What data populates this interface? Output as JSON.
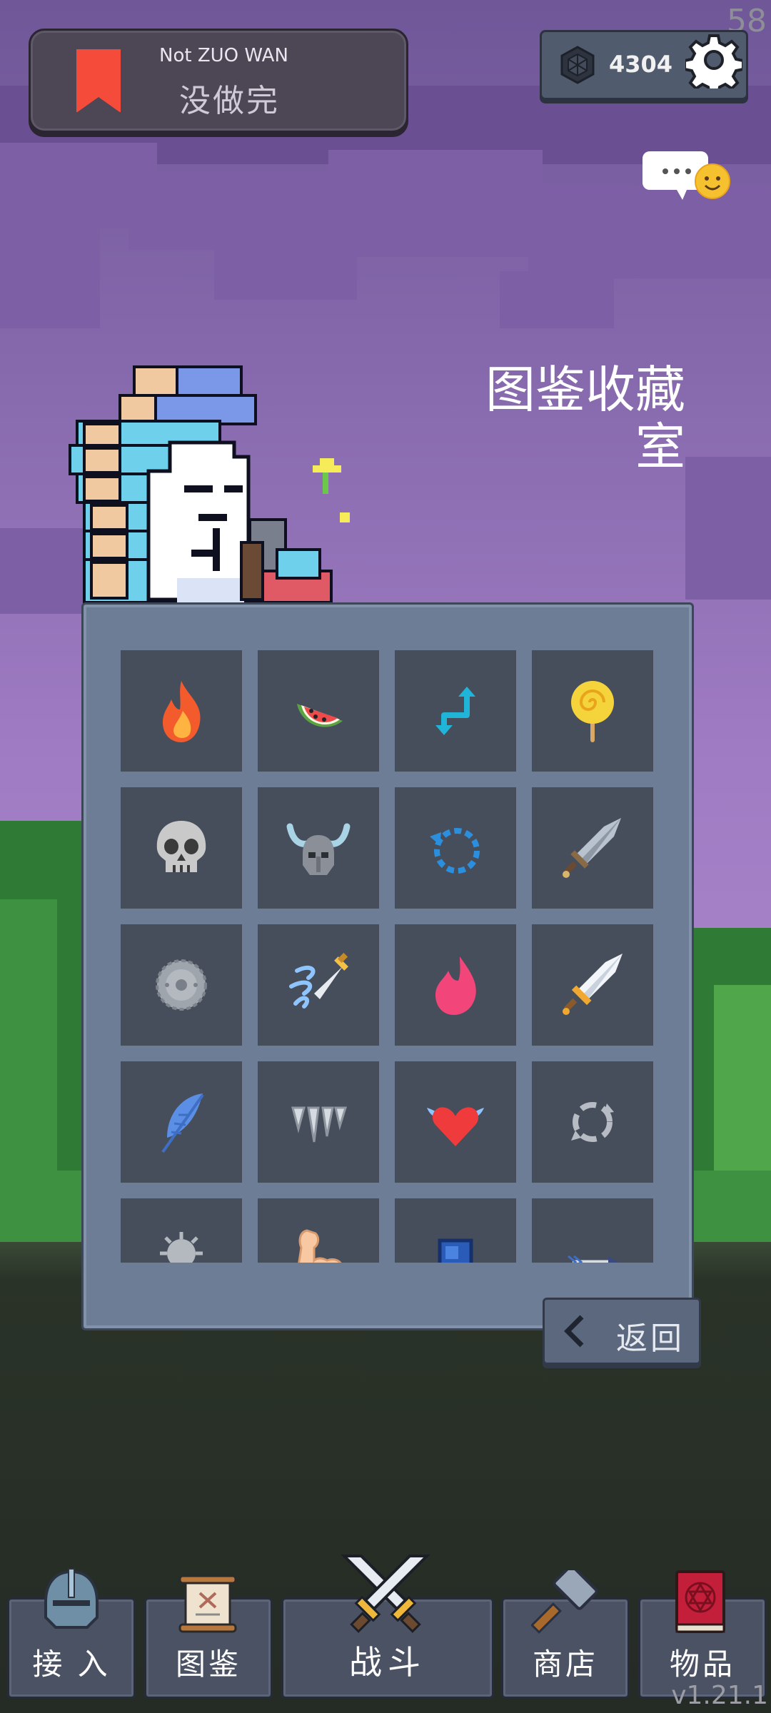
{
  "fps_counter": "58",
  "status": {
    "title_en": "Not ZUO WAN",
    "title_cn": "没做完"
  },
  "currency": {
    "amount": "4304",
    "icon": "hexagon-gem-icon"
  },
  "title": {
    "line1": "图鉴收藏",
    "line2": "室"
  },
  "collection": {
    "items": [
      {
        "icon": "fire-icon"
      },
      {
        "icon": "watermelon-icon"
      },
      {
        "icon": "swap-arrows-icon"
      },
      {
        "icon": "lollipop-icon"
      },
      {
        "icon": "skull-icon"
      },
      {
        "icon": "horned-helmet-icon"
      },
      {
        "icon": "dashed-refresh-icon"
      },
      {
        "icon": "steel-sword-icon"
      },
      {
        "icon": "spiked-buckler-icon"
      },
      {
        "icon": "wind-dagger-icon"
      },
      {
        "icon": "pink-flame-icon"
      },
      {
        "icon": "shiny-sword-icon"
      },
      {
        "icon": "blue-feather-icon"
      },
      {
        "icon": "fangs-icon"
      },
      {
        "icon": "winged-heart-icon"
      },
      {
        "icon": "cycle-arrows-icon"
      },
      {
        "icon": "spiked-mace-icon"
      },
      {
        "icon": "flexed-bicep-icon"
      },
      {
        "icon": "blue-shield-icon"
      },
      {
        "icon": "arrow-icon"
      }
    ]
  },
  "back_button": {
    "label": "返回"
  },
  "nav": [
    {
      "label": "接 入",
      "icon": "knight-helmet-icon"
    },
    {
      "label": "图鉴",
      "icon": "scroll-icon"
    },
    {
      "label": "战斗",
      "icon": "crossed-swords-icon"
    },
    {
      "label": "商店",
      "icon": "hammer-icon"
    },
    {
      "label": "物品",
      "icon": "spellbook-icon"
    }
  ],
  "version": "v1.21.1",
  "colors": {
    "panel": "#6c7d95",
    "slot": "#464e5c",
    "sky": "#a783c9",
    "accent_red": "#f44b3a"
  }
}
